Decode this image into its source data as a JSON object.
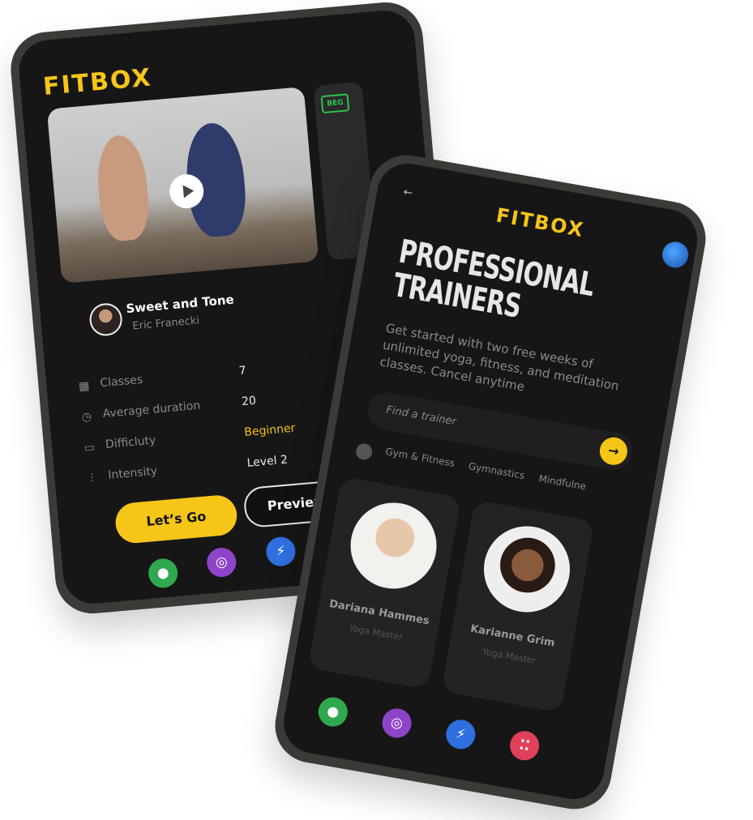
{
  "phone1": {
    "logo": "FITBOX",
    "video": {
      "play_icon": "play-icon"
    },
    "next_card_badge": "BEG",
    "class": {
      "title": "Sweet and Tone",
      "author": "Eric Franecki"
    },
    "stats": [
      {
        "icon": "calendar-icon",
        "label": "Classes",
        "value": "7"
      },
      {
        "icon": "clock-icon",
        "label": "Average duration",
        "value": "20"
      },
      {
        "icon": "gauge-icon",
        "label": "Difficluty",
        "value": "Beginner"
      },
      {
        "icon": "dumbbell-icon",
        "label": "Intensity",
        "value": "Level 2"
      }
    ],
    "buttons": {
      "go": "Let’s Go",
      "preview": "Preview"
    },
    "nav": [
      {
        "icon": "person-icon",
        "color": "#2fa84f"
      },
      {
        "icon": "medal-icon",
        "color": "#8e44c9"
      },
      {
        "icon": "lightning-icon",
        "color": "#2f6fe0"
      },
      {
        "icon": "footprints-icon",
        "color": "#e0405a"
      }
    ]
  },
  "phone2": {
    "logo": "FITBOX",
    "back": "←",
    "title_line1": "PROFESSIONAL",
    "title_line2": "TRAINERS",
    "subtitle": "Get started with two free weeks of unlimited yoga, fitness, and meditation classes. Cancel anytime",
    "search": {
      "placeholder": "Find a trainer",
      "go": "→"
    },
    "filters": [
      "Gym & Fitness",
      "Gymnastics",
      "Mindfulne"
    ],
    "trainers": [
      {
        "name": "Dariana Hammes",
        "role": "Yoga Master"
      },
      {
        "name": "Karianne Grim",
        "role": "Yoga Master"
      }
    ],
    "nav": [
      {
        "icon": "person-icon",
        "color": "#2fa84f"
      },
      {
        "icon": "medal-icon",
        "color": "#8e44c9"
      },
      {
        "icon": "lightning-icon",
        "color": "#2f6fe0"
      },
      {
        "icon": "footprints-icon",
        "color": "#e0405a"
      }
    ]
  }
}
